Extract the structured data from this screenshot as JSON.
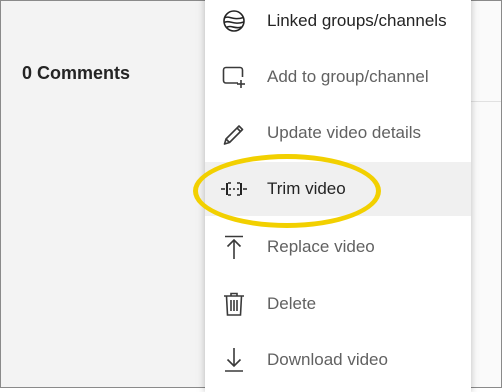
{
  "background": {
    "comments_heading": "0 Comments"
  },
  "menu": {
    "items": [
      {
        "label": "Linked groups/channels",
        "icon": "linked-groups-icon"
      },
      {
        "label": "Add to group/channel",
        "icon": "add-to-channel-icon"
      },
      {
        "label": "Update video details",
        "icon": "pencil-icon"
      },
      {
        "label": "Trim video",
        "icon": "trim-icon",
        "highlighted": true
      },
      {
        "label": "Replace video",
        "icon": "upload-arrow-icon"
      },
      {
        "label": "Delete",
        "icon": "trash-icon"
      },
      {
        "label": "Download video",
        "icon": "download-arrow-icon"
      }
    ]
  },
  "colors": {
    "highlight_ring": "#f2d000",
    "menu_text": "#616161",
    "menu_text_dark": "#242424"
  }
}
